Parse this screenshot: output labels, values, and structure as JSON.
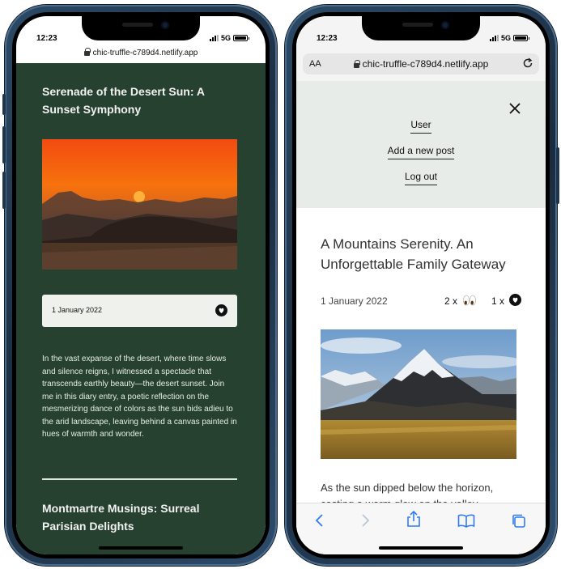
{
  "left_phone": {
    "status": {
      "time": "12:23",
      "network": "5G"
    },
    "url": "chic-truffle-c789d4.netlify.app",
    "post": {
      "title": "Serenade of the Desert Sun: A Sunset Symphony",
      "date": "1 January 2022",
      "excerpt": "In the vast expanse of the desert, where time slows and silence reigns, I witnessed a spectacle that transcends earthly beauty—the desert sunset. Join me in this diary entry, a poetic reflection on the mesmerizing dance of colors as the sun bids adieu to the arid landscape, leaving behind a canvas painted in hues of warmth and wonder."
    },
    "next_post_title": "Montmartre Musings: Surreal Parisian Delights"
  },
  "right_phone": {
    "status": {
      "time": "12:23",
      "network": "5G"
    },
    "aa_label": "AA",
    "url": "chic-truffle-c789d4.netlify.app",
    "menu": {
      "user": "User",
      "add_post": "Add a new post",
      "logout": "Log out"
    },
    "post": {
      "title": "A Mountains Serenity. An Unforgettable Family Gateway",
      "date": "1 January 2022",
      "eyes_count": "2 x",
      "heart_count": "1 x",
      "excerpt": "As the sun dipped below the horizon, casting a warm glow on the valley"
    }
  },
  "colors": {
    "green_bg": "#264130",
    "menu_bg": "#e8ece8",
    "ios_blue": "#2f7cf6"
  }
}
